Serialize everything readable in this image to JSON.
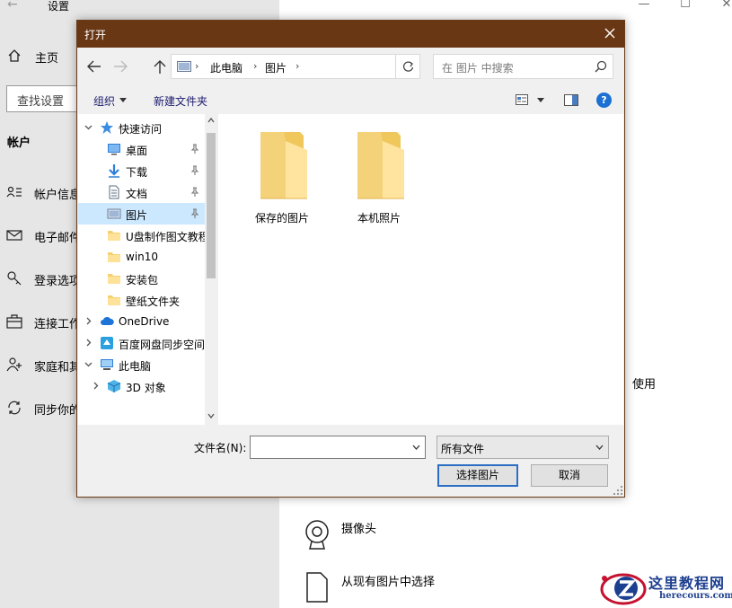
{
  "settings": {
    "title": "设置",
    "back_icon": "back-arrow-icon",
    "home_label": "主页",
    "search_placeholder": "查找设置",
    "section_title": "帐户",
    "nav": [
      {
        "label": "帐户信息",
        "icon": "account-info-icon"
      },
      {
        "label": "电子邮件",
        "icon": "mail-icon"
      },
      {
        "label": "登录选项",
        "icon": "key-icon"
      },
      {
        "label": "连接工作",
        "icon": "briefcase-icon"
      },
      {
        "label": "家庭和其",
        "icon": "family-icon"
      },
      {
        "label": "同步你的",
        "icon": "sync-icon"
      }
    ],
    "right": {
      "use_text": "使用",
      "camera_label": "摄像头",
      "pick_label": "从现有图片中选择"
    }
  },
  "dialog": {
    "title": "打开",
    "title_bar_color": "#6a3714",
    "address": {
      "crumbs": [
        "此电脑",
        "图片"
      ]
    },
    "search_placeholder": "在 图片 中搜索",
    "commands": {
      "organize": "组织",
      "new_folder": "新建文件夹"
    },
    "tree": [
      {
        "label": "快速访问",
        "icon": "star-icon",
        "expander": "down",
        "pinned": false,
        "selected": false,
        "indent": 0
      },
      {
        "label": "桌面",
        "icon": "desktop-icon",
        "expander": "",
        "pinned": true,
        "selected": false,
        "indent": 1
      },
      {
        "label": "下载",
        "icon": "download-icon",
        "expander": "",
        "pinned": true,
        "selected": false,
        "indent": 1
      },
      {
        "label": "文档",
        "icon": "document-icon",
        "expander": "",
        "pinned": true,
        "selected": false,
        "indent": 1
      },
      {
        "label": "图片",
        "icon": "pictures-icon",
        "expander": "",
        "pinned": true,
        "selected": true,
        "indent": 1
      },
      {
        "label": "U盘制作图文教程",
        "icon": "folder-icon",
        "expander": "",
        "pinned": false,
        "selected": false,
        "indent": 1
      },
      {
        "label": "win10",
        "icon": "folder-icon",
        "expander": "",
        "pinned": false,
        "selected": false,
        "indent": 1
      },
      {
        "label": "安装包",
        "icon": "folder-icon",
        "expander": "",
        "pinned": false,
        "selected": false,
        "indent": 1
      },
      {
        "label": "壁纸文件夹",
        "icon": "folder-icon",
        "expander": "",
        "pinned": false,
        "selected": false,
        "indent": 1
      },
      {
        "label": "OneDrive",
        "icon": "cloud-icon",
        "expander": "right",
        "pinned": false,
        "selected": false,
        "indent": 0
      },
      {
        "label": "百度网盘同步空间",
        "icon": "baidu-netdisk-icon",
        "expander": "right",
        "pinned": false,
        "selected": false,
        "indent": 0
      },
      {
        "label": "此电脑",
        "icon": "computer-icon",
        "expander": "down",
        "pinned": false,
        "selected": false,
        "indent": 0
      },
      {
        "label": "3D 对象",
        "icon": "3d-objects-icon",
        "expander": "right",
        "pinned": false,
        "selected": false,
        "indent": 1
      }
    ],
    "folders": [
      {
        "label": "保存的图片",
        "icon": "folder-icon"
      },
      {
        "label": "本机照片",
        "icon": "folder-icon"
      }
    ],
    "filename_label": "文件名(N):",
    "filename_value": "",
    "filetype_value": "所有文件",
    "ok_label": "选择图片",
    "cancel_label": "取消"
  },
  "watermark": {
    "name": "这里教程网",
    "url": "herecours.com"
  }
}
